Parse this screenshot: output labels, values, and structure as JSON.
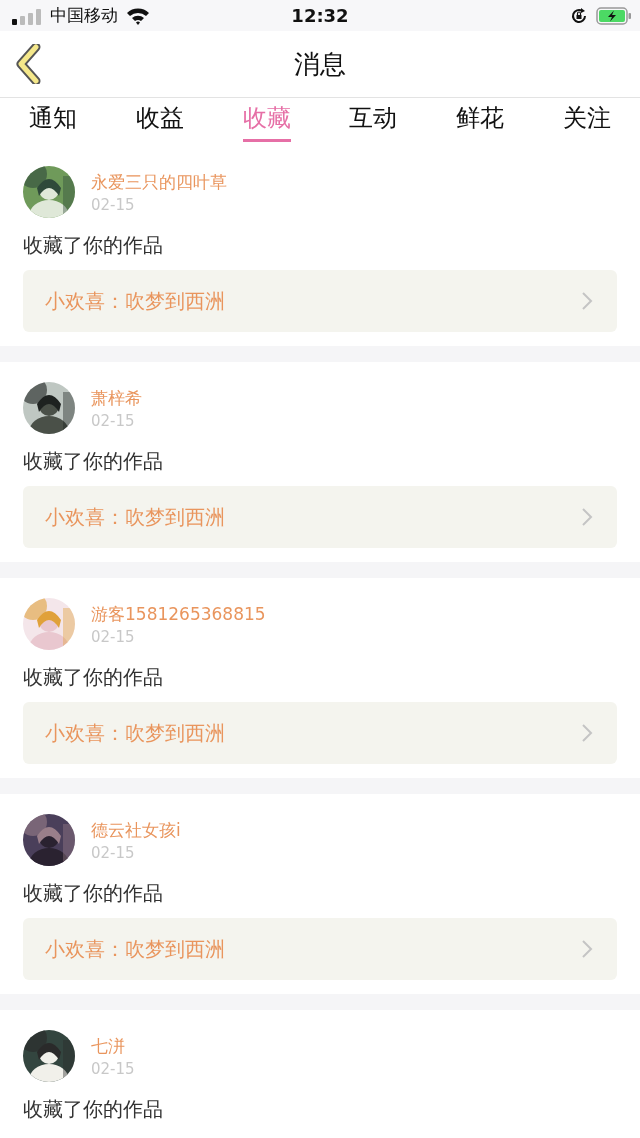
{
  "status_bar": {
    "carrier": "中国移动",
    "time": "12:32"
  },
  "header": {
    "title": "消息"
  },
  "tabs": [
    {
      "label": "通知",
      "selected": false
    },
    {
      "label": "收益",
      "selected": false
    },
    {
      "label": "收藏",
      "selected": true
    },
    {
      "label": "互动",
      "selected": false
    },
    {
      "label": "鲜花",
      "selected": false
    },
    {
      "label": "关注",
      "selected": false
    }
  ],
  "messages": [
    {
      "name": "永爱三只的四叶草",
      "date": "02-15",
      "action": "收藏了你的作品",
      "work": "小欢喜：吹梦到西洲"
    },
    {
      "name": "萧梓希",
      "date": "02-15",
      "action": "收藏了你的作品",
      "work": "小欢喜：吹梦到西洲"
    },
    {
      "name": "游客1581265368815",
      "date": "02-15",
      "action": "收藏了你的作品",
      "work": "小欢喜：吹梦到西洲"
    },
    {
      "name": "德云社女孩i",
      "date": "02-15",
      "action": "收藏了你的作品",
      "work": "小欢喜：吹梦到西洲"
    },
    {
      "name": "七洴",
      "date": "02-15",
      "action": "收藏了你的作品"
    }
  ]
}
